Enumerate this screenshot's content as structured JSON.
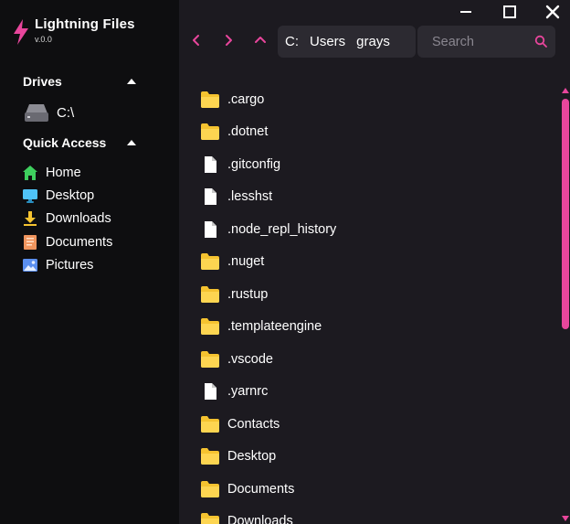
{
  "app": {
    "title": "Lightning Files",
    "version": "v.0.0"
  },
  "colors": {
    "accent": "#e8469c",
    "sidebar_bg": "#0e0e10",
    "main_bg": "#1c1a20",
    "field_bg": "#2c2a31",
    "folder": "#f5c330"
  },
  "sidebar": {
    "drives": {
      "heading": "Drives",
      "items": [
        {
          "label": "C:\\",
          "icon": "drive-icon"
        }
      ]
    },
    "quick_access": {
      "heading": "Quick Access",
      "items": [
        {
          "label": "Home",
          "icon": "home-icon"
        },
        {
          "label": "Desktop",
          "icon": "desktop-icon"
        },
        {
          "label": "Downloads",
          "icon": "download-icon"
        },
        {
          "label": "Documents",
          "icon": "document-icon"
        },
        {
          "label": "Pictures",
          "icon": "picture-icon"
        }
      ]
    }
  },
  "toolbar": {
    "breadcrumb": [
      "C:",
      "Users",
      "grays"
    ],
    "search_placeholder": "Search"
  },
  "files": [
    {
      "name": ".cargo",
      "type": "folder"
    },
    {
      "name": ".dotnet",
      "type": "folder"
    },
    {
      "name": ".gitconfig",
      "type": "file"
    },
    {
      "name": ".lesshst",
      "type": "file"
    },
    {
      "name": ".node_repl_history",
      "type": "file"
    },
    {
      "name": ".nuget",
      "type": "folder"
    },
    {
      "name": ".rustup",
      "type": "folder"
    },
    {
      "name": ".templateengine",
      "type": "folder"
    },
    {
      "name": ".vscode",
      "type": "folder"
    },
    {
      "name": ".yarnrc",
      "type": "file"
    },
    {
      "name": "Contacts",
      "type": "folder"
    },
    {
      "name": "Desktop",
      "type": "folder"
    },
    {
      "name": "Documents",
      "type": "folder"
    },
    {
      "name": "Downloads",
      "type": "folder"
    }
  ]
}
